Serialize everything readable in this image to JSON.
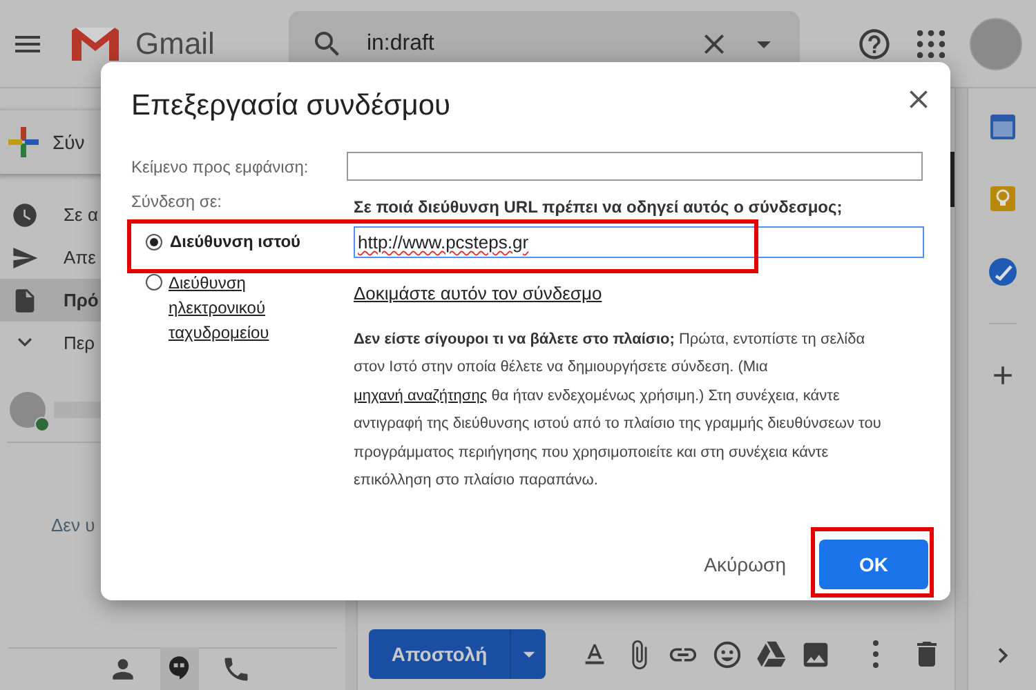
{
  "topbar": {
    "app_name": "Gmail",
    "search": {
      "value": "in:draft"
    }
  },
  "sidebar": {
    "compose_label": "Σύν",
    "items": [
      {
        "label": "Σε α",
        "selected": false
      },
      {
        "label": "Απε",
        "selected": false
      },
      {
        "label": "Πρό",
        "selected": true
      },
      {
        "label": "Περ",
        "selected": false
      }
    ],
    "hangouts_message": "Δεν υ"
  },
  "compose": {
    "send_label": "Αποστολή"
  },
  "dialog": {
    "title": "Επεξεργασία συνδέσμου",
    "display_text_label": "Κείμενο προς εμφάνιση:",
    "link_to_label": "Σύνδεση σε:",
    "options": [
      {
        "label": "Διεύθυνση ιστού",
        "selected": true
      },
      {
        "label": "Διεύθυνση ηλεκτρονικού ταχυδρομείου",
        "selected": false
      }
    ],
    "url_prompt": "Σε ποιά διεύθυνση URL πρέπει να οδηγεί αυτός ο σύνδεσμος;",
    "url_value": "http://www.pcsteps.gr",
    "test_link": "Δοκιμάστε αυτόν τον σύνδεσμο",
    "help": [
      {
        "kind": "text",
        "text": "**Δεν είστε σίγουροι τι να βάλετε στο πλαίσιο;** Πρώτα, εντοπίστε τη σελίδα στον Ιστό στην οποία θέλετε να δημιουργήσετε σύνδεση. (Μια"
      },
      {
        "kind": "link",
        "text": "μηχανή αναζήτησης"
      },
      {
        "kind": "text",
        "text": "θα ήταν ενδεχομένως χρήσιμη.) Στη συνέχεια, κάντε αντιγραφή της διεύθυνσης ιστού από το πλαίσιο της γραμμής διευθύνσεων του προγράμματος περιήγησης που χρησιμοποιείτε και στη συνέχεια κάντε επικόλληση στο πλαίσιο παραπάνω."
      }
    ],
    "buttons": [
      {
        "label": "Ακύρωση",
        "kind": "text"
      },
      {
        "label": "OK",
        "kind": "primary"
      }
    ]
  }
}
